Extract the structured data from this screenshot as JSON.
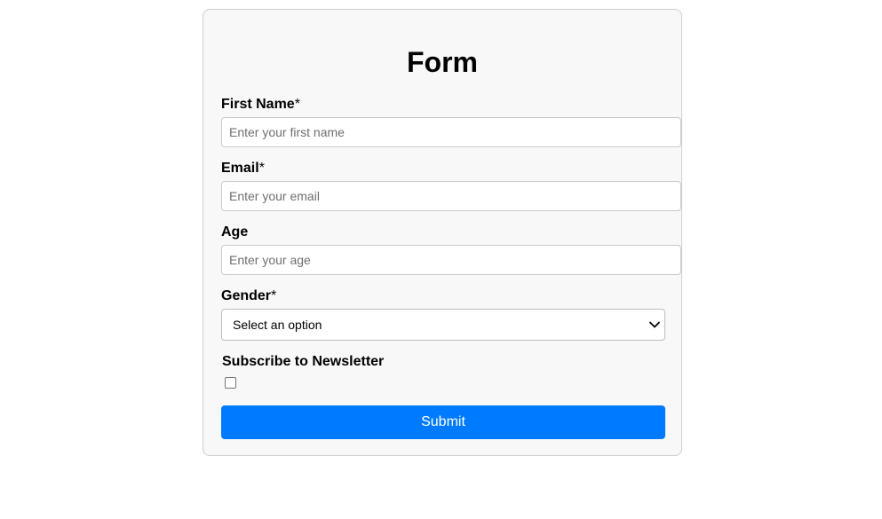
{
  "form": {
    "title": "Form",
    "first_name": {
      "label": "First Name",
      "required_mark": "*",
      "placeholder": "Enter your first name",
      "value": ""
    },
    "email": {
      "label": "Email",
      "required_mark": "*",
      "placeholder": "Enter your email",
      "value": ""
    },
    "age": {
      "label": "Age",
      "placeholder": "Enter your age",
      "value": ""
    },
    "gender": {
      "label": "Gender",
      "required_mark": "*",
      "selected": "Select an option"
    },
    "newsletter": {
      "label": "Subscribe to Newsletter",
      "checked": false
    },
    "submit_label": "Submit"
  },
  "colors": {
    "accent": "#007bff",
    "card_background": "#f8f8f8",
    "card_border": "#cfcfcf"
  },
  "icons": {
    "select_chevron": "chevron-down-icon"
  }
}
